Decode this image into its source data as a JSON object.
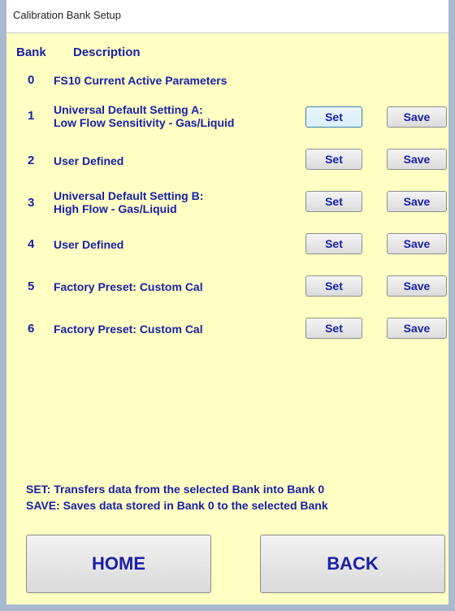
{
  "window": {
    "title": "Calibration Bank Setup"
  },
  "headers": {
    "bank": "Bank",
    "description": "Description"
  },
  "banks": [
    {
      "num": "0",
      "desc": "FS10 Current Active Parameters"
    },
    {
      "num": "1",
      "desc": "Universal Default Setting A:\nLow Flow Sensitivity - Gas/Liquid",
      "set": "Set",
      "save": "Save"
    },
    {
      "num": "2",
      "desc": "User Defined",
      "set": "Set",
      "save": "Save"
    },
    {
      "num": "3",
      "desc": "Universal Default Setting B:\nHigh Flow - Gas/Liquid",
      "set": "Set",
      "save": "Save"
    },
    {
      "num": "4",
      "desc": "User Defined",
      "set": "Set",
      "save": "Save"
    },
    {
      "num": "5",
      "desc": "Factory Preset: Custom Cal",
      "set": "Set",
      "save": "Save"
    },
    {
      "num": "6",
      "desc": "Factory Preset: Custom Cal",
      "set": "Set",
      "save": "Save"
    }
  ],
  "info": {
    "set_help": "SET: Transfers data from the selected Bank into Bank 0",
    "save_help": "SAVE: Saves data stored in Bank 0 to the selected Bank"
  },
  "nav": {
    "home": "HOME",
    "back": "BACK"
  },
  "colors": {
    "background": "#ffffc4",
    "text": "#1a20a8",
    "frame": "#a9b9cf"
  }
}
